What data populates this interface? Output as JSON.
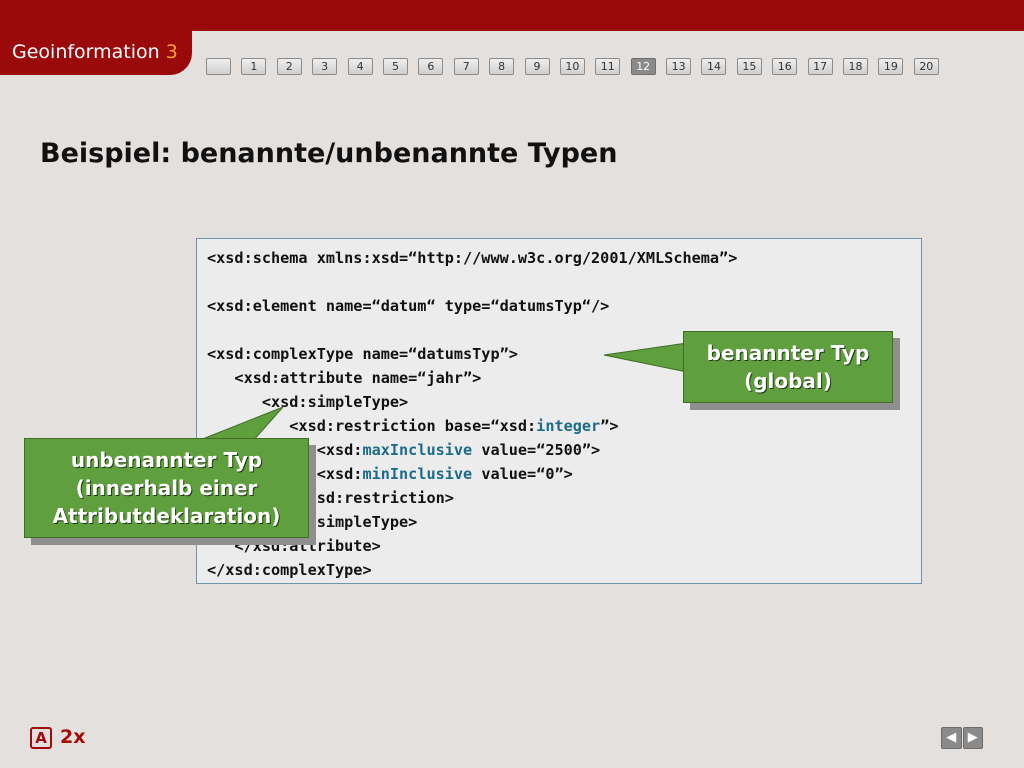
{
  "header": {
    "app_title": "Geoinformation",
    "app_number": "3",
    "pages": [
      "",
      "1",
      "2",
      "3",
      "4",
      "5",
      "6",
      "7",
      "8",
      "9",
      "10",
      "11",
      "12",
      "13",
      "14",
      "15",
      "16",
      "17",
      "18",
      "19",
      "20"
    ],
    "active_page": "12"
  },
  "slide": {
    "title": "Beispiel: benannte/unbenannte Typen"
  },
  "code": {
    "line1": "<xsd:schema xmlns:xsd=“http://www.w3c.org/2001/XMLSchema”>",
    "line2": "<xsd:element name=“datum“ type=“datumsTyp“/>",
    "line3": "<xsd:complexType name=“datumsTyp”>",
    "line4": "   <xsd:attribute name=“jahr”>",
    "line5": "      <xsd:simpleType>",
    "line6_a": "         <xsd:restriction base=“xsd:",
    "line6_kw": "integer",
    "line6_b": "”>",
    "line7_a": "            <xsd:",
    "line7_kw": "maxInclusive",
    "line7_b": " value=“2500”>",
    "line8_a": "            <xsd:",
    "line8_kw": "minInclusive",
    "line8_b": " value=“0”>",
    "line9": "         </xsd:restriction>",
    "line10": "      </xsd:simpleType>",
    "line11": "   </xsd:attribute>",
    "line12": "</xsd:complexType>"
  },
  "callouts": {
    "right_line1": "benannter Typ",
    "right_line2": "(global)",
    "left_line1": "unbenannter Typ",
    "left_line2": "(innerhalb einer",
    "left_line3": "Attributdeklaration)"
  },
  "footer": {
    "badge": "A",
    "label": "2x",
    "prev_icon": "◀",
    "next_icon": "▶"
  },
  "colors": {
    "brand_red": "#9b0a0a",
    "accent_orange": "#f4a23a",
    "callout_green": "#5f9f3d",
    "keyword_teal": "#1b6b8a"
  }
}
